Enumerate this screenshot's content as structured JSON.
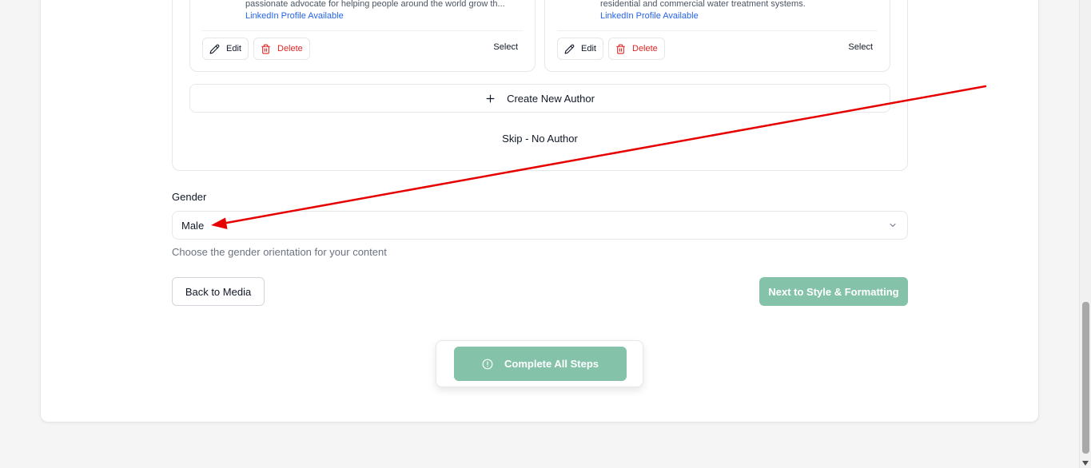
{
  "author_cards": [
    {
      "bio": "passionate advocate for helping people around the world grow th...",
      "link": "LinkedIn Profile Available",
      "edit_label": "Edit",
      "delete_label": "Delete",
      "select_label": "Select"
    },
    {
      "bio": "residential and commercial water treatment systems.",
      "link": "LinkedIn Profile Available",
      "edit_label": "Edit",
      "delete_label": "Delete",
      "select_label": "Select"
    }
  ],
  "author_actions": {
    "create_label": "Create New Author",
    "skip_label": "Skip - No Author"
  },
  "gender": {
    "label": "Gender",
    "value": "Male",
    "help": "Choose the gender orientation for your content"
  },
  "navigation": {
    "back_label": "Back to Media",
    "next_label": "Next to Style & Formatting"
  },
  "complete": {
    "label": "Complete All Steps"
  },
  "colors": {
    "accent_disabled": "#84c2aa",
    "danger": "#dc2626",
    "link": "#2563eb",
    "annotation_arrow": "#e60000"
  },
  "icons": [
    "edit-icon",
    "trash-icon",
    "plus-icon",
    "chevron-down-icon",
    "info-circle-icon"
  ]
}
